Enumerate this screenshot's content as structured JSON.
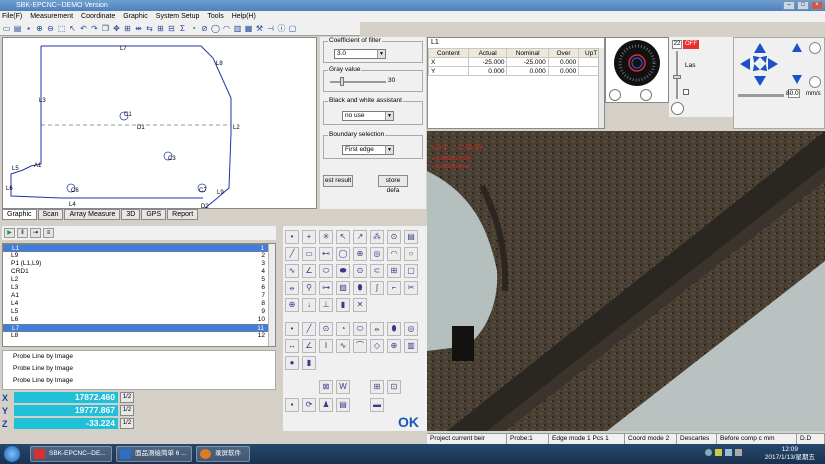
{
  "window": {
    "title": "SBK-EPCNC--DEMO Version"
  },
  "menu": [
    "File(F)",
    "Measurement",
    "Coordinate",
    "Graphic",
    "System Setup",
    "Tools",
    "Help(H)"
  ],
  "graphic": {
    "labels": {
      "L7": "L7",
      "L8": "L8",
      "L3": "L3",
      "L2": "L2",
      "D1": "D1",
      "C1": "C1",
      "C3": "C3",
      "A1": "A1",
      "L6": "L6",
      "C6": "C6",
      "C7": "C7",
      "L9": "L9",
      "L5": "L5",
      "L4": "L4",
      "D2": "D2"
    }
  },
  "tabs": [
    "Graphic",
    "Scan",
    "Array Measure",
    "3D",
    "GPS",
    "Report"
  ],
  "settings": {
    "filter_title": "Coefficient of filter",
    "filter_value": "3.0",
    "gray_title": "Gray value",
    "gray_value": "30",
    "bw_title": "Black and white assistant",
    "bw_value": "no use",
    "boundary_title": "Boundary selection",
    "boundary_value": "First edge",
    "test_btn": "est result",
    "store_btn": "store defa"
  },
  "results": {
    "title": "L1",
    "headers": [
      "Content",
      "Actual",
      "Nominal",
      "Over",
      "UpT"
    ],
    "rows": [
      {
        "content": "X",
        "actual": "-25.000",
        "nominal": "-25.000",
        "over": "0.000"
      },
      {
        "content": "Y",
        "actual": "0.000",
        "nominal": "0.000",
        "over": "0.000"
      }
    ]
  },
  "light": {
    "value": "22",
    "unit_label": "Las"
  },
  "jog": {
    "speed": "80.0",
    "unit": "mm/s"
  },
  "elements": [
    {
      "label": "L1",
      "num": "1",
      "selected": true
    },
    {
      "label": "L9",
      "num": "2"
    },
    {
      "label": "P1 (L1,L9)",
      "num": "3"
    },
    {
      "label": "CRD1",
      "num": "4"
    },
    {
      "label": "L2",
      "num": "5"
    },
    {
      "label": "L3",
      "num": "6"
    },
    {
      "label": "A1",
      "num": "7"
    },
    {
      "label": "L4",
      "num": "8"
    },
    {
      "label": "L5",
      "num": "9"
    },
    {
      "label": "L6",
      "num": "10"
    },
    {
      "label": "L7",
      "num": "11",
      "selected": true
    },
    {
      "label": "L8",
      "num": "12"
    }
  ],
  "probes": [
    "Probe Line by Image",
    "Probe Line by Image",
    "Probe Line by Image"
  ],
  "coords": [
    {
      "axis": "X",
      "value": "17872.460",
      "half": "1/2"
    },
    {
      "axis": "Y",
      "value": "19777.867",
      "half": "1/2"
    },
    {
      "axis": "Z",
      "value": "-33.224",
      "half": "1/2"
    }
  ],
  "ok_label": "OK",
  "camera_overlay": {
    "line1": "L 0:1 ... 2: 31.53",
    "line2": "x 0.00001(0.00)",
    "line3": "y 0.003(0.0)ms"
  },
  "status": [
    "Project current beir",
    "Probe:1",
    "Edge mode 1 Pcs 1",
    "Coord mode 2",
    "Descartes",
    "Before comp c mm",
    "D.D"
  ],
  "taskbar": {
    "items": [
      "SBK-EPCNC--DE...",
      "面品测绘简单 6 ...",
      "录屏软件"
    ],
    "time": "12:09",
    "date": "2017/1/13/星期五"
  },
  "colors": {
    "accent": "#3d7ee3",
    "coord_bg": "#20c0d8",
    "ok": "#1758b6",
    "overlay": "#e02020"
  }
}
